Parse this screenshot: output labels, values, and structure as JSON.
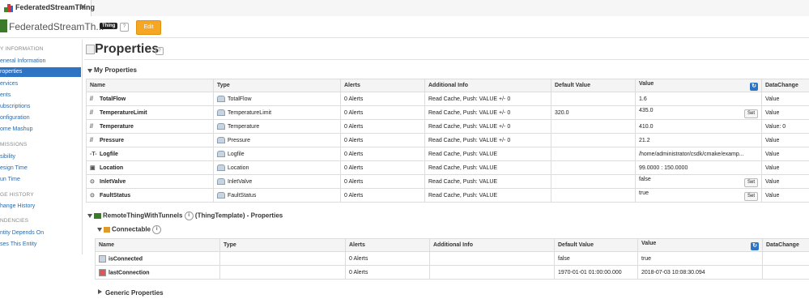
{
  "tab": {
    "label": "FederatedStreamThing",
    "close": "✕"
  },
  "header": {
    "title": "FederatedStreamTh...",
    "badge": "Thing",
    "help": "?",
    "edit_label": "Edit"
  },
  "sidebar": {
    "sections": [
      {
        "heading": "Y INFORMATION",
        "items": [
          "eneral Information",
          "roperties",
          "ervices",
          "ents",
          "ubscriptions",
          "onfiguration",
          "ome Mashup"
        ]
      },
      {
        "heading": "MISSIONS",
        "items": [
          "sibility",
          "esign Time",
          "un Time"
        ]
      },
      {
        "heading": "GE HISTORY",
        "items": [
          "hange History"
        ]
      },
      {
        "heading": "NDENCIES",
        "items": [
          "ntity Depends On",
          "ses This Entity"
        ]
      }
    ],
    "active": "roperties"
  },
  "page": {
    "title": "Properties",
    "help": "?"
  },
  "my_properties": {
    "title": "My Properties",
    "columns": [
      "Name",
      "Type",
      "Alerts",
      "Additional Info",
      "Default Value",
      "Value",
      "DataChange"
    ],
    "refresh_icon": "refresh-icon",
    "rows": [
      {
        "glyph": "//",
        "name": "TotalFlow",
        "type": "TotalFlow",
        "alerts": "0 Alerts",
        "info": "Read Cache, Push: VALUE +/- 0",
        "default": "",
        "value": "1.6",
        "set": "",
        "change": "Value"
      },
      {
        "glyph": "//",
        "name": "TemperatureLimit",
        "type": "TemperatureLimit",
        "alerts": "0 Alerts",
        "info": "Read Cache, Push: VALUE +/- 0",
        "default": "320.0",
        "value": "435.0",
        "set": "Set",
        "change": "Value"
      },
      {
        "glyph": "//",
        "name": "Temperature",
        "type": "Temperature",
        "alerts": "0 Alerts",
        "info": "Read Cache, Push: VALUE +/- 0",
        "default": "",
        "value": "410.0",
        "set": "",
        "change": "Value: 0"
      },
      {
        "glyph": "//",
        "name": "Pressure",
        "type": "Pressure",
        "alerts": "0 Alerts",
        "info": "Read Cache, Push: VALUE +/- 0",
        "default": "",
        "value": "21.2",
        "set": "",
        "change": "Value"
      },
      {
        "glyph": "-T-",
        "name": "Logfile",
        "type": "Logfile",
        "alerts": "0 Alerts",
        "info": "Read Cache, Push: VALUE",
        "default": "",
        "value": "/home/administrator/csdk/cmake/examp...",
        "set": "",
        "change": "Value"
      },
      {
        "glyph": "▣",
        "name": "Location",
        "type": "Location",
        "alerts": "0 Alerts",
        "info": "Read Cache, Push: VALUE",
        "default": "",
        "value": "99.0000 : 150.0000",
        "set": "",
        "change": "Value"
      },
      {
        "glyph": "⊙",
        "name": "InletValve",
        "type": "InletValve",
        "alerts": "0 Alerts",
        "info": "Read Cache, Push: VALUE",
        "default": "",
        "value": "false",
        "set": "Set",
        "change": "Value"
      },
      {
        "glyph": "⊙",
        "name": "FaultStatus",
        "type": "FaultStatus",
        "alerts": "0 Alerts",
        "info": "Read Cache, Push: VALUE",
        "default": "",
        "value": "true",
        "set": "Set",
        "change": "Value"
      }
    ]
  },
  "template_section": {
    "name": "RemoteThingWithTunnels",
    "suffix": "(ThingTemplate) - Properties",
    "info": "i"
  },
  "connectable": {
    "title": "Connectable",
    "info": "i",
    "columns": [
      "Name",
      "Type",
      "Alerts",
      "Additional Info",
      "Default Value",
      "Value",
      "DataChange"
    ],
    "rows": [
      {
        "name": "isConnected",
        "type": "",
        "alerts": "0 Alerts",
        "info": "",
        "default": "false",
        "value": "true",
        "change": ""
      },
      {
        "name": "lastConnection",
        "type": "",
        "alerts": "0 Alerts",
        "info": "",
        "default": "1970-01-01 01:00:00.000",
        "value": "2018-07-03 10:08:30.094",
        "change": ""
      }
    ]
  },
  "generic": {
    "title": "Generic Properties"
  },
  "colors": {
    "accent": "#2d74c4",
    "edit": "#f5a623"
  }
}
